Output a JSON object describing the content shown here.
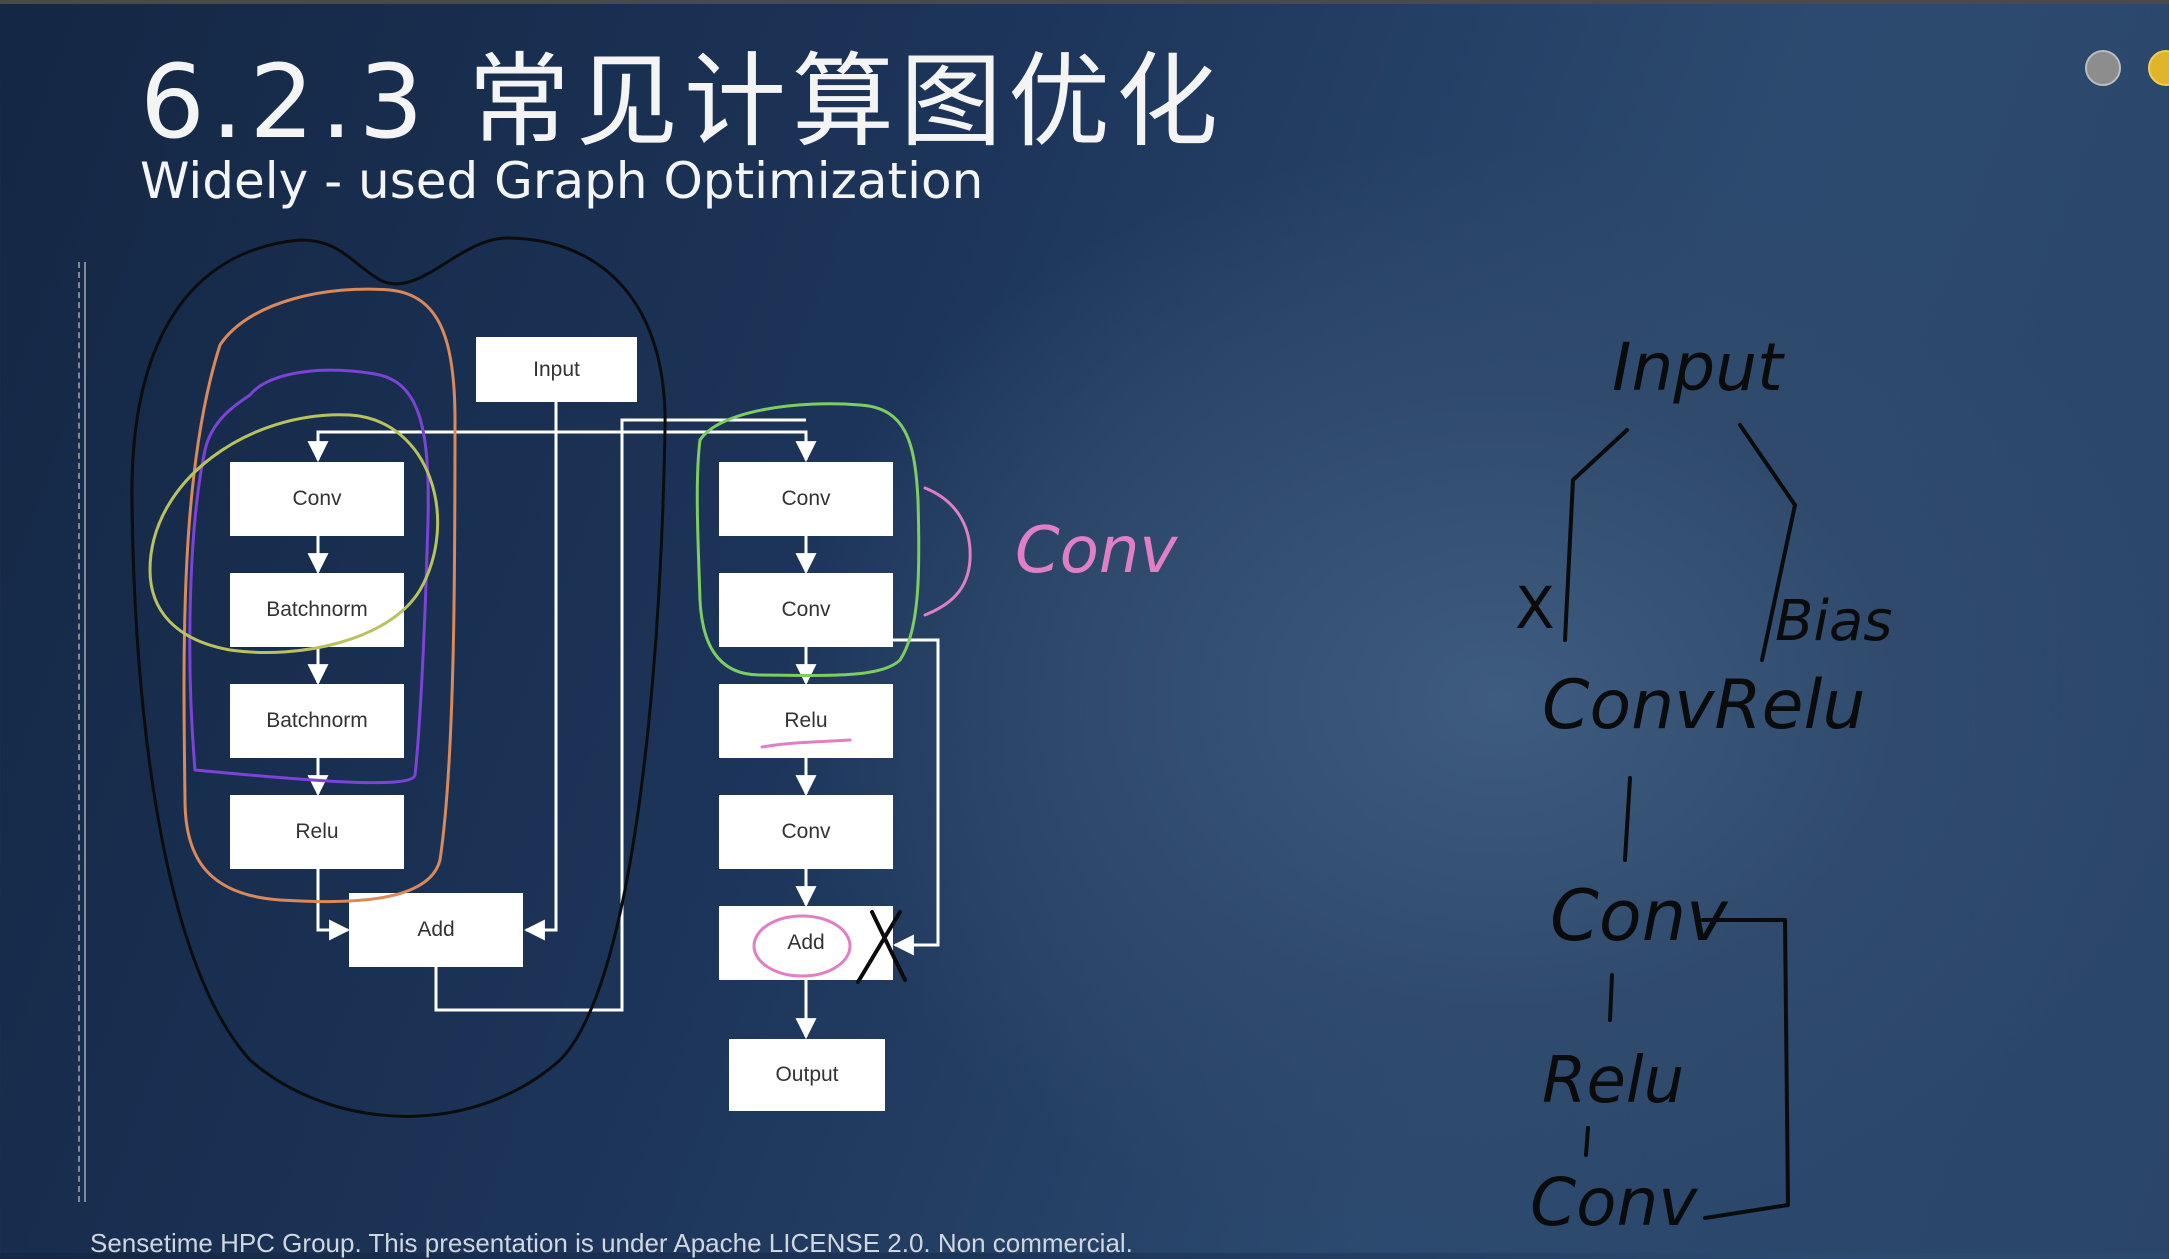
{
  "slide": {
    "title": "6.2.3 常见计算图优化",
    "subtitle": "Widely - used Graph Optimization",
    "footer": "Sensetime HPC Group. This presentation is under Apache LICENSE 2.0. Non commercial."
  },
  "diagram": {
    "input": "Input",
    "left_branch": [
      "Conv",
      "Batchnorm",
      "Batchnorm",
      "Relu"
    ],
    "left_add": "Add",
    "right_branch": [
      "Conv",
      "Conv",
      "Relu",
      "Conv"
    ],
    "right_add": "Add",
    "output": "Output"
  },
  "annotations": {
    "conv_note": "Conv",
    "input": "Input",
    "x": "X",
    "bias": "Bias",
    "convrelu": "ConvRelu",
    "conv1": "Conv",
    "relu": "Relu",
    "conv2": "Conv"
  },
  "colors": {
    "arrow": "#ffffff",
    "black_circle": "#0c0c0c",
    "orange_circle": "#d9895a",
    "purple_circle": "#7d42d6",
    "yellow_circle": "#b9c25d",
    "green_circle": "#7ccd62",
    "pink_ink": "#e07fc6",
    "handwriting": "#0b0b0b"
  }
}
